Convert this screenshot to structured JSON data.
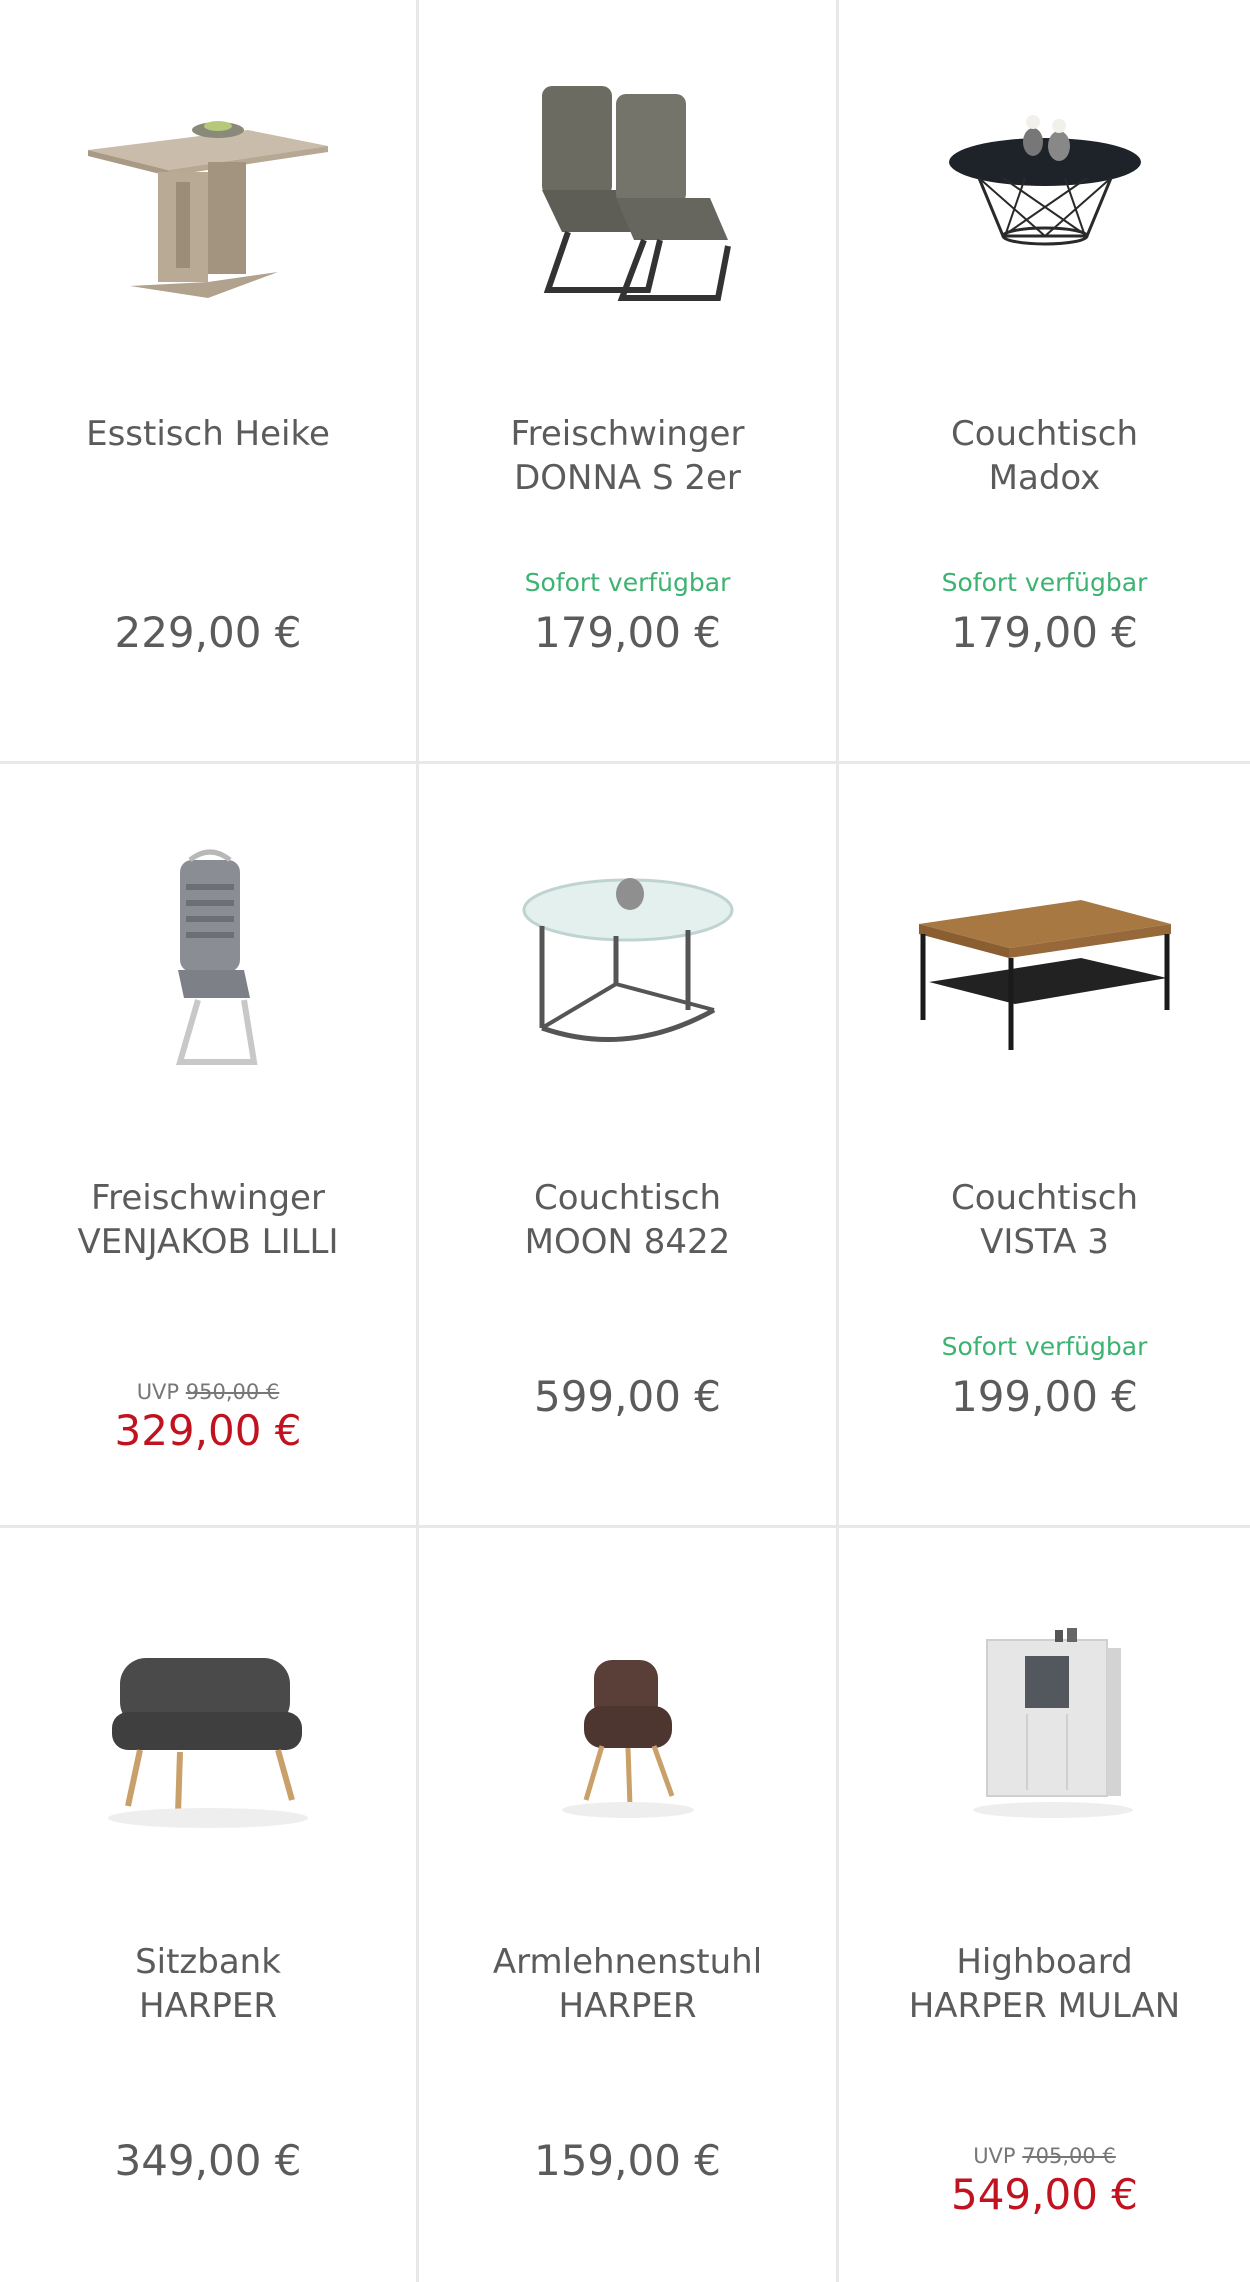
{
  "colors": {
    "availability": "#3cb371",
    "sale_price": "#c1121f",
    "text": "#5b5b5b",
    "divider": "#e8e8e8"
  },
  "products": [
    {
      "title_line1": "Esstisch Heike",
      "title_line2": "",
      "availability": "",
      "uvp_label": "",
      "uvp_price": "",
      "price": "229,00 €",
      "icon": "dining-table-icon"
    },
    {
      "title_line1": "Freischwinger",
      "title_line2": "DONNA S 2er",
      "availability": "Sofort verfügbar",
      "uvp_label": "",
      "uvp_price": "",
      "price": "179,00 €",
      "icon": "cantilever-chairs-icon"
    },
    {
      "title_line1": "Couchtisch",
      "title_line2": "Madox",
      "availability": "Sofort verfügbar",
      "uvp_label": "",
      "uvp_price": "",
      "price": "179,00 €",
      "icon": "wire-coffee-table-icon"
    },
    {
      "title_line1": "Freischwinger",
      "title_line2": "VENJAKOB LILLI",
      "availability": "",
      "uvp_label": "UVP",
      "uvp_price": "950,00 €",
      "price": "329,00 €",
      "icon": "cantilever-chair-icon"
    },
    {
      "title_line1": "Couchtisch",
      "title_line2": "MOON 8422",
      "availability": "",
      "uvp_label": "",
      "uvp_price": "",
      "price": "599,00 €",
      "icon": "glass-coffee-table-icon"
    },
    {
      "title_line1": "Couchtisch",
      "title_line2": "VISTA 3",
      "availability": "Sofort verfügbar",
      "uvp_label": "",
      "uvp_price": "",
      "price": "199,00 €",
      "icon": "wood-coffee-table-icon"
    },
    {
      "title_line1": "Sitzbank",
      "title_line2": "HARPER",
      "availability": "",
      "uvp_label": "",
      "uvp_price": "",
      "price": "349,00 €",
      "icon": "bench-icon"
    },
    {
      "title_line1": "Armlehnenstuhl",
      "title_line2": "HARPER",
      "availability": "",
      "uvp_label": "",
      "uvp_price": "",
      "price": "159,00 €",
      "icon": "armchair-icon"
    },
    {
      "title_line1": "Highboard",
      "title_line2": "HARPER MULAN",
      "availability": "",
      "uvp_label": "UVP",
      "uvp_price": "705,00 €",
      "price": "549,00 €",
      "icon": "highboard-icon"
    }
  ]
}
